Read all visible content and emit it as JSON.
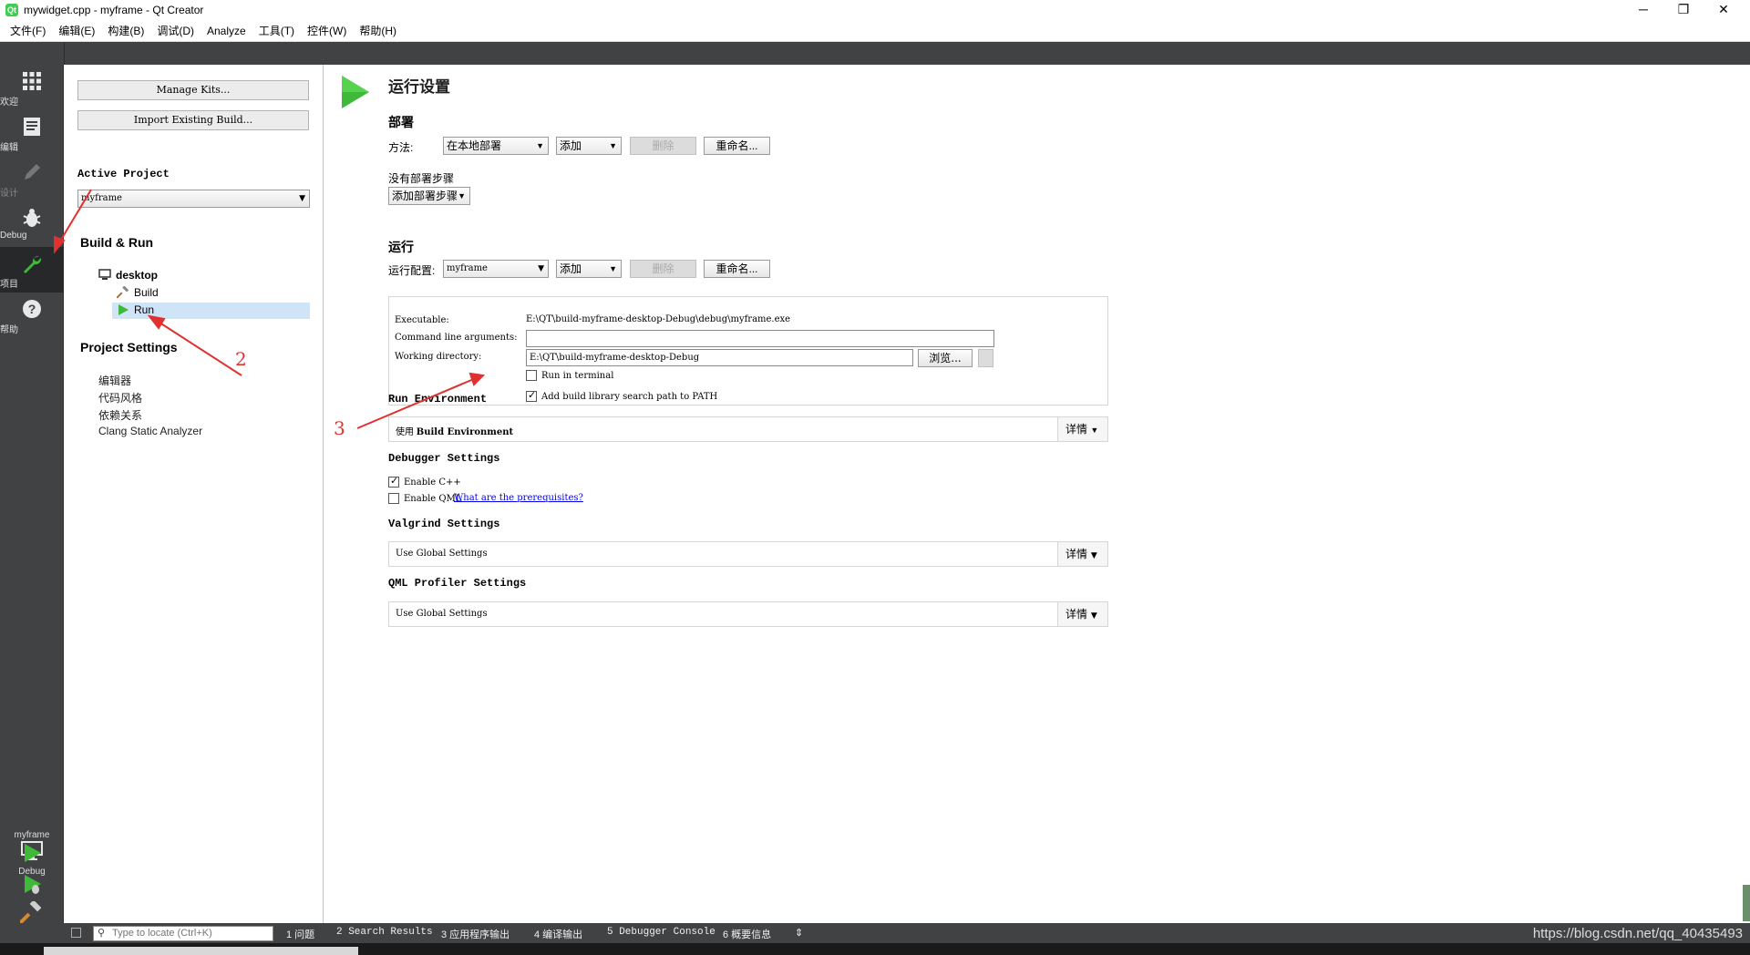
{
  "window": {
    "icon_text": "Qt",
    "title": "mywidget.cpp - myframe - Qt Creator",
    "minimize": "─",
    "restore": "❐",
    "close": "✕"
  },
  "menu": [
    "文件(F)",
    "编辑(E)",
    "构建(B)",
    "调试(D)",
    "Analyze",
    "工具(T)",
    "控件(W)",
    "帮助(H)"
  ],
  "modes": [
    {
      "label": "欢迎",
      "icon": "grid-icon"
    },
    {
      "label": "编辑",
      "icon": "edit-doc-icon"
    },
    {
      "label": "设计",
      "icon": "pencil-icon"
    },
    {
      "label": "Debug",
      "icon": "bug-icon"
    },
    {
      "label": "项目",
      "icon": "wrench-icon"
    },
    {
      "label": "帮助",
      "icon": "help-icon"
    }
  ],
  "kit_selector": {
    "project": "myframe",
    "config": "Debug"
  },
  "left_panel": {
    "manage_kits": "Manage Kits...",
    "import_build": "Import Existing Build...",
    "active_project_label": "Active Project",
    "active_project_value": "myframe",
    "build_run_title": "Build & Run",
    "kit_name": "desktop",
    "build_item": "Build",
    "run_item": "Run",
    "project_settings_title": "Project Settings",
    "settings_items": [
      "编辑器",
      "代码风格",
      "依赖关系",
      "Clang Static Analyzer"
    ]
  },
  "main": {
    "title": "运行设置",
    "deploy": {
      "heading": "部署",
      "method_label": "方法:",
      "method_value": "在本地部署",
      "add": "添加",
      "remove": "删除",
      "rename": "重命名...",
      "no_steps": "没有部署步骤",
      "add_step": "添加部署步骤"
    },
    "run": {
      "heading": "运行",
      "config_label": "运行配置:",
      "config_value": "myframe",
      "add": "添加",
      "remove": "删除",
      "rename": "重命名...",
      "executable_label": "Executable:",
      "executable_value": "E:\\QT\\build-myframe-desktop-Debug\\debug\\myframe.exe",
      "args_label": "Command line arguments:",
      "args_value": "",
      "workdir_label": "Working directory:",
      "workdir_value": "E:\\QT\\build-myframe-desktop-Debug",
      "browse": "浏览...",
      "run_in_terminal": "Run in terminal",
      "run_in_terminal_checked": false,
      "add_lib_path": "Add build library search path to PATH",
      "add_lib_path_checked": true
    },
    "run_env": {
      "heading": "Run Environment",
      "value_prefix": "使用",
      "value": "Build Environment",
      "details": "详情"
    },
    "debugger": {
      "heading": "Debugger Settings",
      "enable_cpp": "Enable C++",
      "enable_cpp_checked": true,
      "enable_qml": "Enable QML",
      "enable_qml_checked": false,
      "prereq_link": "What are the prerequisites?"
    },
    "valgrind": {
      "heading": "Valgrind Settings",
      "value": "Use Global Settings",
      "details": "详情"
    },
    "qml_profiler": {
      "heading": "QML Profiler Settings",
      "value": "Use Global Settings",
      "details": "详情"
    }
  },
  "status": {
    "locator_placeholder": "Type to locate (Ctrl+K)",
    "panes": [
      "1 问题",
      "2 Search Results",
      "3 应用程序输出",
      "4 编译输出",
      "5 Debugger Console",
      "6 概要信息"
    ],
    "watermark": "https://blog.csdn.net/qq_40435493"
  },
  "annotations": [
    "2",
    "3"
  ],
  "colors": {
    "sidebar": "#404244",
    "accent_green": "#3fb93a",
    "selection": "#cfe5f7",
    "annotation": "#e03030"
  }
}
